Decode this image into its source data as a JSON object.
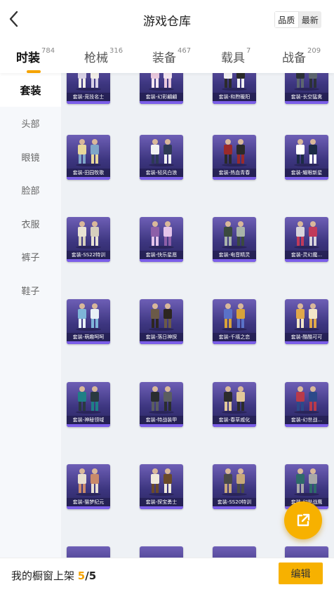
{
  "header": {
    "title": "游戏仓库",
    "sort_options": [
      "品质",
      "最新"
    ]
  },
  "tabs": [
    {
      "label": "时装",
      "count": "784"
    },
    {
      "label": "枪械",
      "count": "316"
    },
    {
      "label": "装备",
      "count": "467"
    },
    {
      "label": "载具",
      "count": "7"
    },
    {
      "label": "战备",
      "count": "209"
    }
  ],
  "sidebar": {
    "items": [
      "套装",
      "头部",
      "眼镜",
      "脸部",
      "衣服",
      "裤子",
      "鞋子"
    ]
  },
  "grid": {
    "rows": [
      [
        "套装-竞技名士",
        "套装-幻彩翩翩",
        "套装-和煦暖阳",
        "套装-长空猛禽"
      ],
      [
        "套装-田园牧歌",
        "套装-轻风白浪",
        "套装-热血青春",
        "套装-耀眼新星"
      ],
      [
        "套装-SS22特训",
        "套装-快乐星愿",
        "套装-电音精灵",
        "套装-灵幻魔..."
      ],
      [
        "套装-萌趣呵呵",
        "套装-落日神探",
        "套装-千禧之恋",
        "套装-酷酷可可"
      ],
      [
        "套装-神秘领域",
        "套装-特战装甲",
        "套装-春草戚化",
        "套装-幻世战..."
      ],
      [
        "套装-猫梦纪元",
        "套装-探宝勇士",
        "套装-SS20特训",
        "套装-幻世战鹰"
      ],
      [
        "",
        "",
        "",
        ""
      ]
    ]
  },
  "footer": {
    "label": "我的橱窗上架",
    "current": "5",
    "total": "/5",
    "edit_label": "编辑"
  }
}
